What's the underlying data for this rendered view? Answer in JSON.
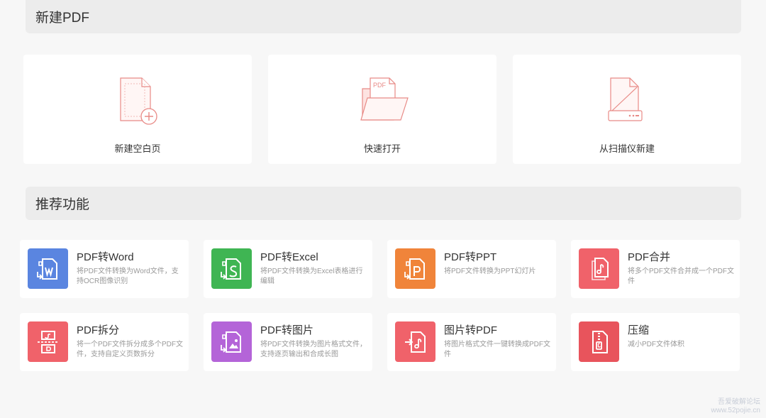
{
  "sections": {
    "new_pdf": "新建PDF",
    "recommended": "推荐功能"
  },
  "new_actions": [
    {
      "label": "新建空白页",
      "icon": "blank-page-plus-icon"
    },
    {
      "label": "快速打开",
      "icon": "open-folder-icon"
    },
    {
      "label": "从扫描仪新建",
      "icon": "scanner-icon"
    }
  ],
  "features": [
    {
      "title": "PDF转Word",
      "desc": "将PDF文件转换为Word文件，支持OCR图像识别",
      "color": "#5a85e0",
      "icon": "pdf-to-word-icon"
    },
    {
      "title": "PDF转Excel",
      "desc": "将PDF文件转换为Excel表格进行编辑",
      "color": "#3fb553",
      "icon": "pdf-to-excel-icon"
    },
    {
      "title": "PDF转PPT",
      "desc": "将PDF文件转换为PPT幻灯片",
      "color": "#f0843a",
      "icon": "pdf-to-ppt-icon"
    },
    {
      "title": "PDF合并",
      "desc": "将多个PDF文件合并成一个PDF文件",
      "color": "#f0626a",
      "icon": "pdf-merge-icon"
    },
    {
      "title": "PDF拆分",
      "desc": "将一个PDF文件拆分成多个PDF文件，支持自定义页数拆分",
      "color": "#f0626a",
      "icon": "pdf-split-icon"
    },
    {
      "title": "PDF转图片",
      "desc": "将PDF文件转换为图片格式文件，支持逐页输出和合成长图",
      "color": "#b464d8",
      "icon": "pdf-to-image-icon"
    },
    {
      "title": "图片转PDF",
      "desc": "将图片格式文件一键转换成PDF文件",
      "color": "#f0626a",
      "icon": "image-to-pdf-icon"
    },
    {
      "title": "压缩",
      "desc": "减小PDF文件体积",
      "color": "#e8545c",
      "icon": "compress-icon"
    }
  ],
  "icon_text": {
    "pdf_tag": "PDF"
  },
  "watermark": {
    "line1": "吾爱破解论坛",
    "line2": "www.52pojie.cn"
  }
}
